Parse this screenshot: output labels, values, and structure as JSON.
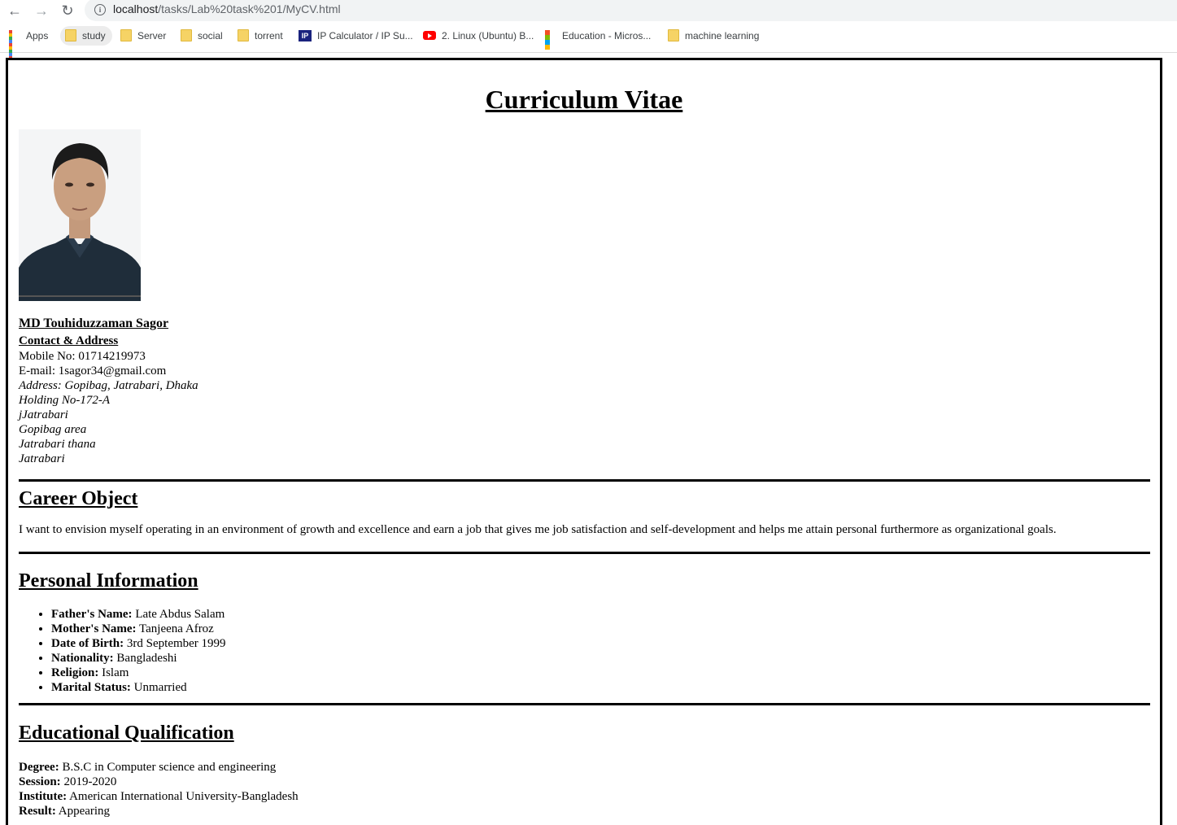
{
  "browser": {
    "url_host": "localhost",
    "url_path": "/tasks/Lab%20task%201/MyCV.html",
    "bookmarks": [
      {
        "label": "Apps",
        "icon": "apps-grid-icon"
      },
      {
        "label": "study",
        "icon": "folder-icon"
      },
      {
        "label": "Server",
        "icon": "folder-icon"
      },
      {
        "label": "social",
        "icon": "folder-icon"
      },
      {
        "label": "torrent",
        "icon": "folder-icon"
      },
      {
        "label": "IP Calculator / IP Su...",
        "icon": "ip-icon"
      },
      {
        "label": "2. Linux (Ubuntu) B...",
        "icon": "youtube-icon"
      },
      {
        "label": "Education - Micros...",
        "icon": "microsoft-icon"
      },
      {
        "label": "machine learning",
        "icon": "folder-icon"
      }
    ]
  },
  "cv": {
    "title": "Curriculum Vitae",
    "name": "MD Touhiduzzaman Sagor",
    "contact_heading": "Contact & Address",
    "mobile": "Mobile No: 01714219973",
    "email": "E-mail: 1sagor34@gmail.com",
    "address_lines": [
      "Address: Gopibag, Jatrabari, Dhaka",
      "Holding No-172-A",
      "jJatrabari",
      "Gopibag area",
      "Jatrabari thana",
      "Jatrabari"
    ],
    "career_heading": "Career Object",
    "career_text": "I want to envision myself operating in an environment of growth and excellence and earn a job that gives me job satisfaction and self-development and helps me attain personal furthermore as organizational goals.",
    "personal_heading": "Personal Information",
    "personal": [
      {
        "label": "Father's Name:",
        "value": " Late Abdus Salam"
      },
      {
        "label": "Mother's Name:",
        "value": " Tanjeena Afroz"
      },
      {
        "label": "Date of Birth:",
        "value": " 3rd September 1999"
      },
      {
        "label": "Nationality:",
        "value": " Bangladeshi"
      },
      {
        "label": "Religion:",
        "value": " Islam"
      },
      {
        "label": "Marital Status:",
        "value": " Unmarried"
      }
    ],
    "education_heading": "Educational Qualification",
    "education": [
      {
        "label": "Degree:",
        "value": " B.S.C in Computer science and engineering"
      },
      {
        "label": "Session:",
        "value": " 2019-2020"
      },
      {
        "label": "Institute:",
        "value": " American International University-Bangladesh"
      },
      {
        "label": "Result:",
        "value": " Appearing"
      }
    ]
  }
}
